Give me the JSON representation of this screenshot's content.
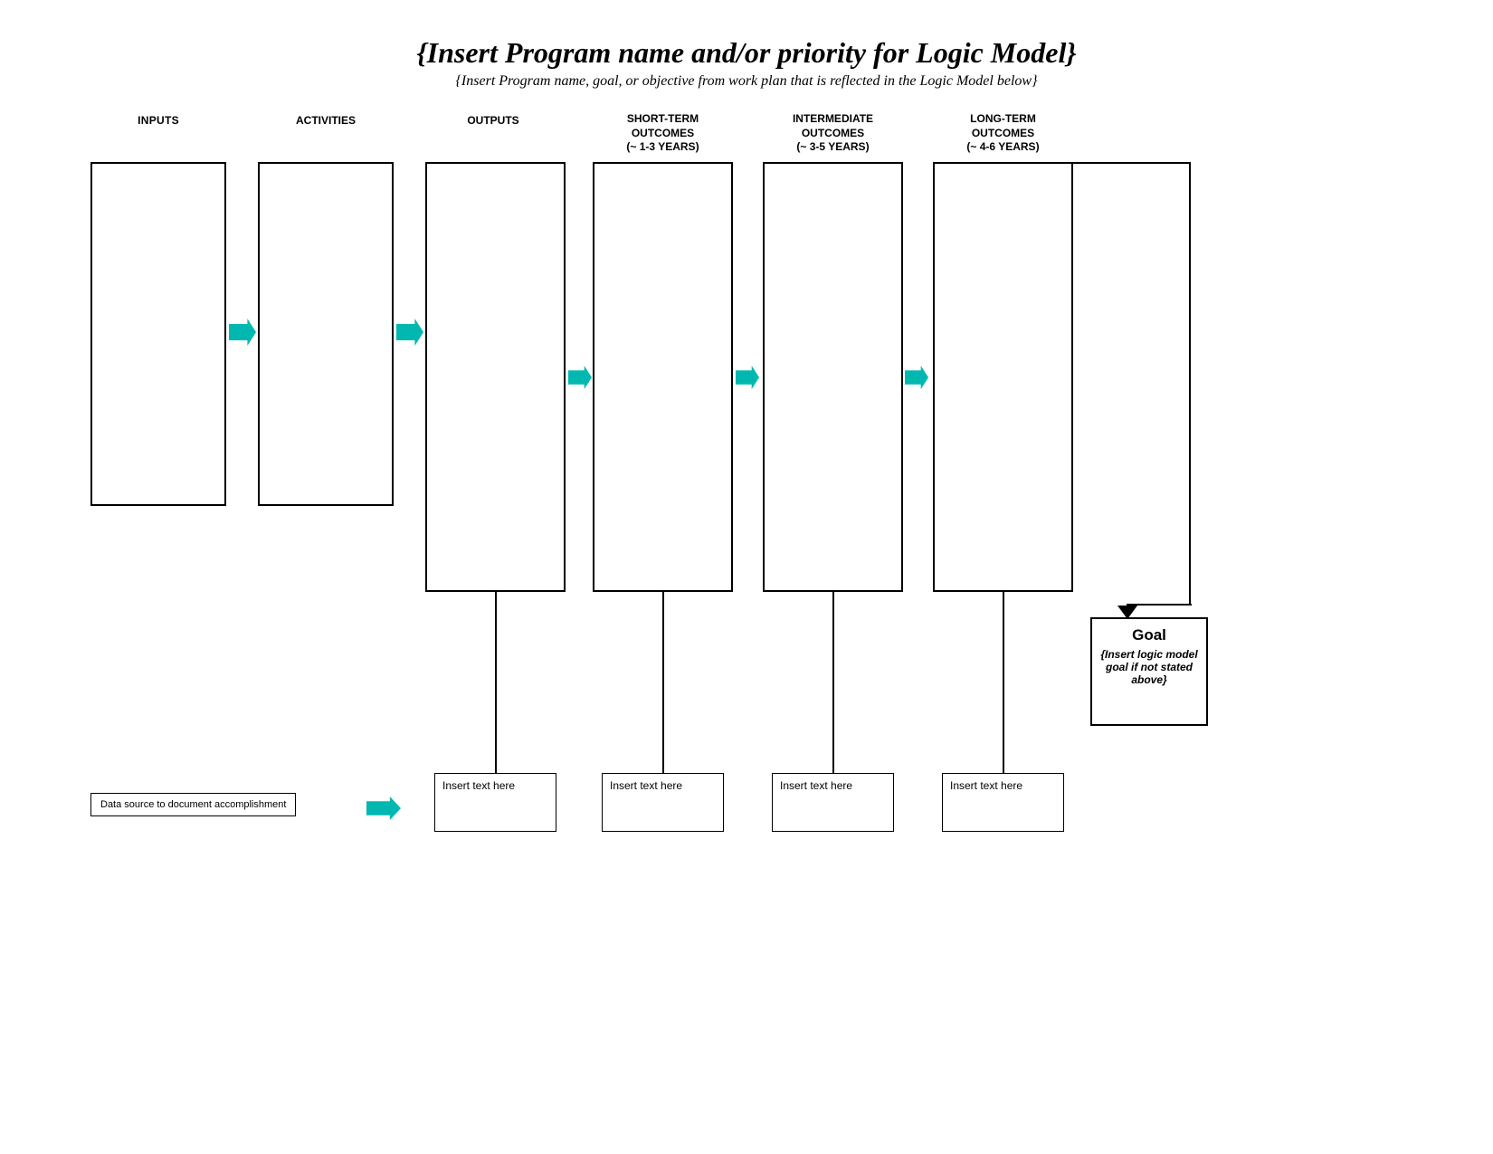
{
  "header": {
    "main_title": "{Insert Program name and/or priority for Logic Model}",
    "subtitle": "{Insert Program name, goal, or objective from work plan that is reflected in the Logic Model below}"
  },
  "columns": [
    {
      "id": "inputs",
      "label": "INPUTS",
      "label_lines": [
        "INPUTS"
      ],
      "has_bottom_box": false
    },
    {
      "id": "activities",
      "label": "ACTIVITIES",
      "label_lines": [
        "ACTIVITIES"
      ],
      "has_bottom_box": false
    },
    {
      "id": "outputs",
      "label": "OUTPUTS",
      "label_lines": [
        "OUTPUTS"
      ],
      "has_bottom_box": true,
      "bottom_text": "Insert text here"
    },
    {
      "id": "short-term",
      "label": "SHORT-TERM OUTCOMES (~ 1-3 years)",
      "label_lines": [
        "SHORT-TERM",
        "OUTCOMES",
        "(~ 1-3 years)"
      ],
      "has_bottom_box": true,
      "bottom_text": "Insert text here"
    },
    {
      "id": "intermediate",
      "label": "INTERMEDIATE OUTCOMES (~ 3-5 years)",
      "label_lines": [
        "INTERMEDIATE",
        "OUTCOMES",
        "(~ 3-5 years)"
      ],
      "has_bottom_box": true,
      "bottom_text": "Insert text here"
    },
    {
      "id": "long-term",
      "label": "LONG-TERM OUTCOMES (~ 4-6 years)",
      "label_lines": [
        "LONG-TERM",
        "OUTCOMES",
        "(~ 4-6 years)"
      ],
      "has_bottom_box": true,
      "bottom_text": "Insert text here"
    }
  ],
  "goal": {
    "label": "Goal",
    "subtext": "{Insert logic model goal if not stated above}"
  },
  "data_source": {
    "label": "Data source to document accomplishment"
  },
  "colors": {
    "teal": "#00b8b0",
    "black": "#000000",
    "white": "#ffffff"
  }
}
